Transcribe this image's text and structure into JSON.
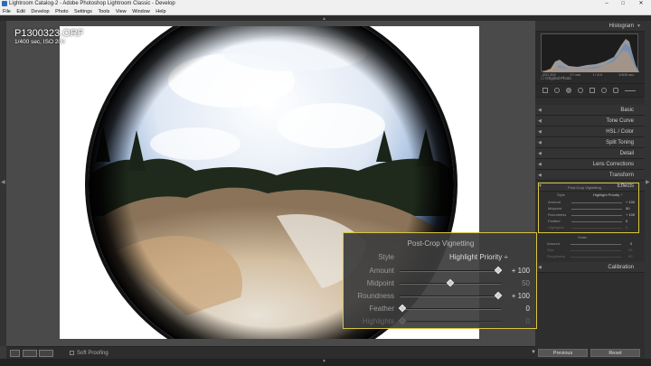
{
  "window": {
    "title": "Lightroom Catalog-2 - Adobe Photoshop Lightroom Classic - Develop",
    "minimize": "–",
    "maximize": "□",
    "close": "✕"
  },
  "menu": [
    "File",
    "Edit",
    "Develop",
    "Photo",
    "Settings",
    "Tools",
    "View",
    "Window",
    "Help"
  ],
  "photo_info": {
    "filename": "P1300323.ORF",
    "exif": "1/400 sec, ISO 200"
  },
  "toolbar": {
    "soft_proofing": "Soft Proofing"
  },
  "right_panel": {
    "histogram": "Histogram",
    "histogram_labels": {
      "left": "ISO 200",
      "mid1": "17 mm",
      "mid2": "f / 8.0",
      "right": "1/400 sec"
    },
    "original_photo": "Original Photo",
    "panels": [
      "Basic",
      "Tone Curve",
      "HSL / Color",
      "Split Toning",
      "Detail",
      "Lens Corrections",
      "Transform",
      "Effects"
    ],
    "calibration": "Calibration",
    "grain_label": "Grain",
    "grain_rows": [
      {
        "label": "Amount",
        "value": "0"
      },
      {
        "label": "Size",
        "value": "25"
      },
      {
        "label": "Roughness",
        "value": "50"
      }
    ],
    "previous": "Previous",
    "reset": "Reset"
  },
  "vignetting": {
    "title": "Post-Crop Vignetting",
    "style_label": "Style",
    "style_value": "Highlight Priority ÷",
    "rows": [
      {
        "label": "Amount",
        "value": "+ 100",
        "pos": 1.0,
        "dim": false
      },
      {
        "label": "Midpoint",
        "value": "50",
        "pos": 0.5,
        "dim": false
      },
      {
        "label": "Roundness",
        "value": "+ 100",
        "pos": 1.0,
        "dim": false
      },
      {
        "label": "Feather",
        "value": "0",
        "pos": 0.0,
        "dim": false
      },
      {
        "label": "Highlights",
        "value": "0",
        "pos": 0.0,
        "dim": true
      }
    ]
  },
  "colors": {
    "accent_border": "#d9c541",
    "panel_bg": "#2e2e2e",
    "workspace_bg": "#4a4a4a"
  }
}
